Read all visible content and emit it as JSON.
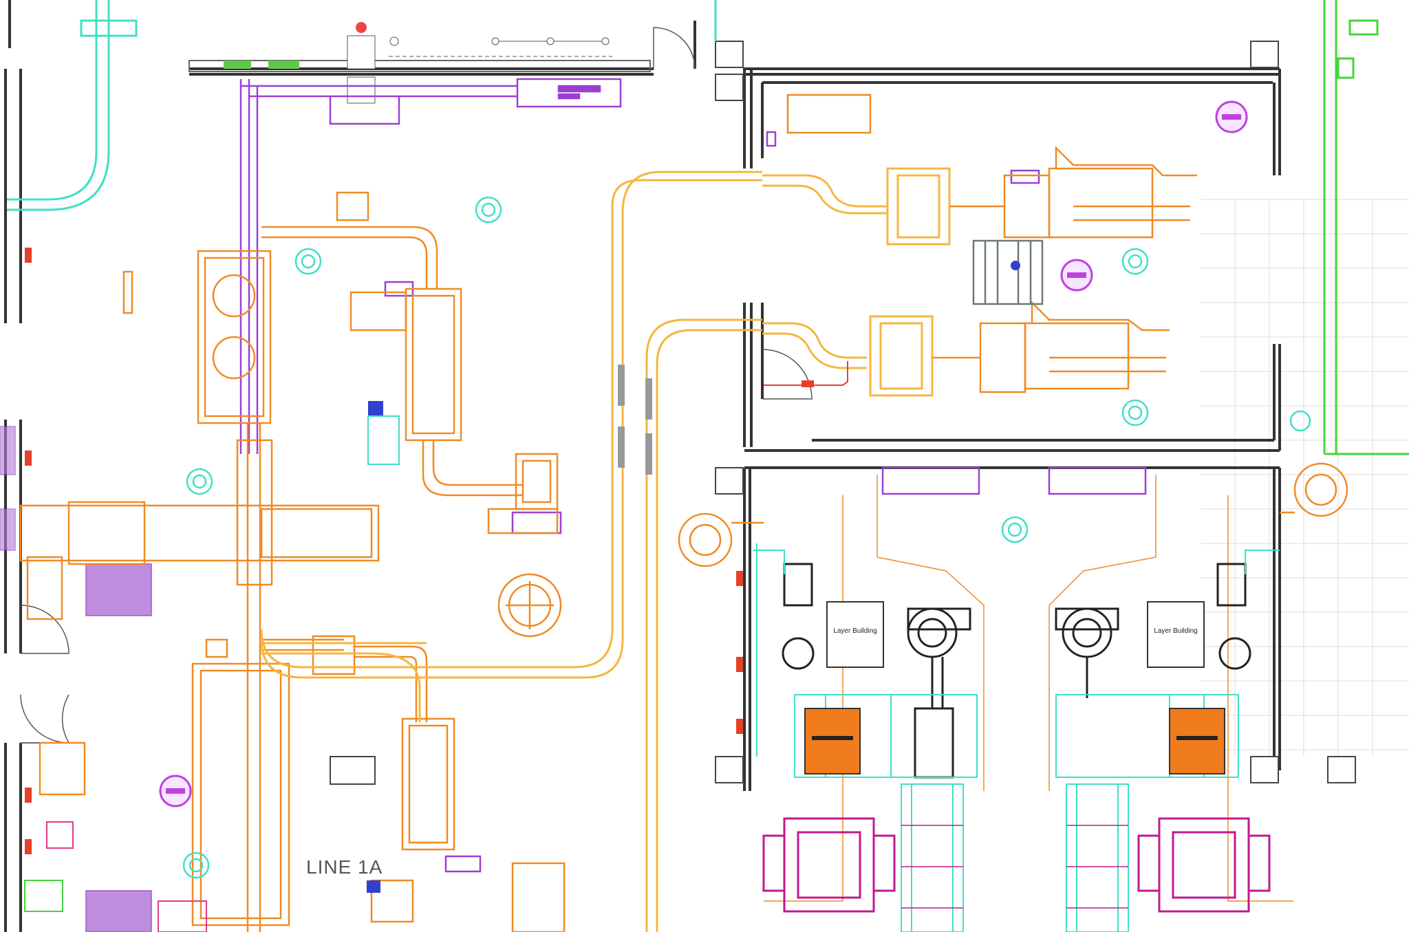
{
  "labels": {
    "line_label": "LINE 1A",
    "layer_building_left": "Layer Building",
    "layer_building_right": "Layer Building"
  },
  "colors": {
    "wall": "#333333",
    "orange_equipment": "#f08a24",
    "yellow_conveyor": "#f5b640",
    "purple_equipment": "#9b3fd4",
    "cyan_outline": "#3fe0c5",
    "green_line": "#45d43a",
    "magenta_equipment": "#c2188f",
    "orange_fill": "#f07c1e",
    "grid": "#d8d8d8"
  },
  "icons": [
    "no-entry-icon",
    "operator-station-icon",
    "door-swing-icon",
    "column-icon"
  ]
}
